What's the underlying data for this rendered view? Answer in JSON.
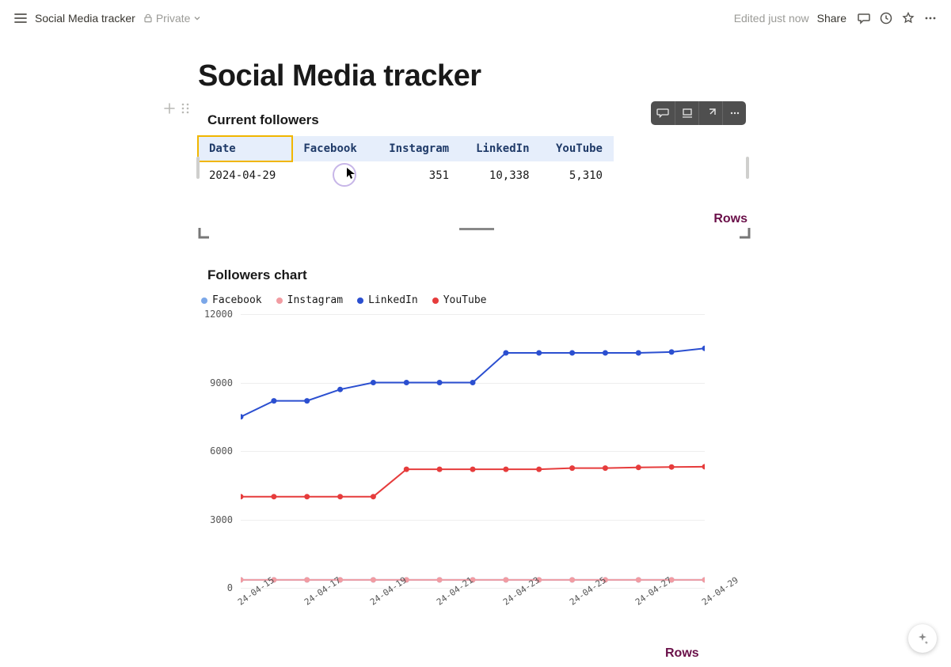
{
  "topbar": {
    "breadcrumb": "Social Media tracker",
    "private_label": "Private",
    "edited_label": "Edited just now",
    "share_label": "Share"
  },
  "page": {
    "title": "Social Media tracker"
  },
  "table_block": {
    "heading": "Current followers",
    "headers": [
      "Date",
      "Facebook",
      "Instagram",
      "LinkedIn",
      "YouTube"
    ],
    "rows": [
      {
        "date": "2024-04-29",
        "facebook": "",
        "instagram": "351",
        "linkedin": "10,338",
        "youtube": "5,310"
      }
    ]
  },
  "rows_link_label": "Rows",
  "chart_block": {
    "heading": "Followers chart",
    "legend": [
      {
        "label": "Facebook",
        "color": "#7ba7e8"
      },
      {
        "label": "Instagram",
        "color": "#f19ca2"
      },
      {
        "label": "LinkedIn",
        "color": "#2b4fd0"
      },
      {
        "label": "YouTube",
        "color": "#e63c3c"
      }
    ],
    "y_ticks": [
      12000,
      9000,
      6000,
      3000,
      0
    ],
    "y_tick_labels": [
      "12000",
      "9000",
      "6000",
      "3000",
      "0"
    ],
    "x_tick_labels": [
      "24-04-15",
      "24-04-17",
      "24-04-19",
      "24-04-21",
      "24-04-23",
      "24-04-25",
      "24-04-27",
      "24-04-29"
    ],
    "x_range": [
      0,
      14
    ],
    "y_range": [
      0,
      12000
    ]
  },
  "chart_data": {
    "type": "line",
    "title": "Followers chart",
    "xlabel": "",
    "ylabel": "",
    "ylim": [
      0,
      12000
    ],
    "categories": [
      "24-04-15",
      "24-04-16",
      "24-04-17",
      "24-04-18",
      "24-04-19",
      "24-04-20",
      "24-04-21",
      "24-04-22",
      "24-04-23",
      "24-04-24",
      "24-04-25",
      "24-04-26",
      "24-04-27",
      "24-04-28",
      "24-04-29"
    ],
    "series": [
      {
        "name": "Facebook",
        "color": "#7ba7e8",
        "values": [
          350,
          350,
          350,
          350,
          350,
          350,
          350,
          350,
          350,
          350,
          350,
          350,
          350,
          350,
          351
        ]
      },
      {
        "name": "Instagram",
        "color": "#f19ca2",
        "values": [
          350,
          350,
          350,
          350,
          350,
          350,
          350,
          350,
          350,
          350,
          350,
          350,
          350,
          350,
          351
        ]
      },
      {
        "name": "LinkedIn",
        "color": "#2b4fd0",
        "values": [
          7500,
          8200,
          8200,
          8700,
          9000,
          9000,
          9000,
          9000,
          10300,
          10300,
          10300,
          10300,
          10300,
          10338,
          10500
        ]
      },
      {
        "name": "YouTube",
        "color": "#e63c3c",
        "values": [
          4000,
          4000,
          4000,
          4000,
          4000,
          5200,
          5200,
          5200,
          5200,
          5200,
          5250,
          5250,
          5280,
          5300,
          5310
        ]
      }
    ]
  }
}
